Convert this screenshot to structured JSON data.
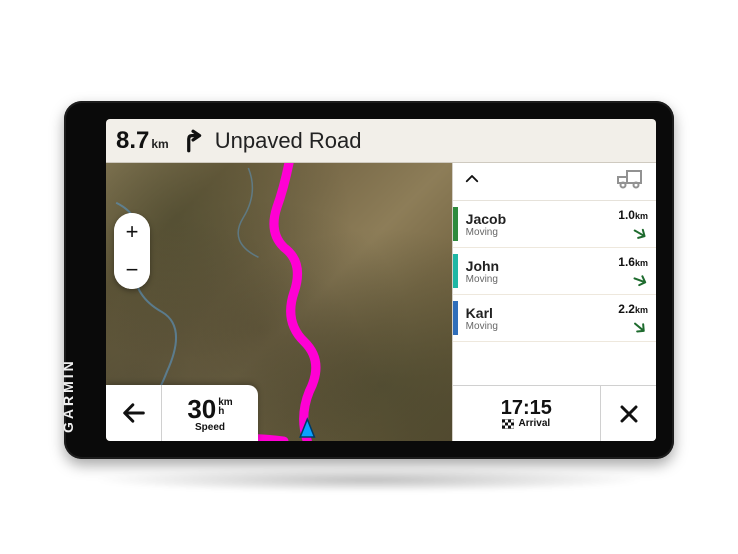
{
  "brand": "GARMIN",
  "nav": {
    "distance_value": "8.7",
    "distance_unit": "km",
    "turn_icon": "turn-right-icon",
    "road_name": "Unpaved Road"
  },
  "zoom": {
    "in_label": "+",
    "out_label": "−"
  },
  "speed": {
    "value": "30",
    "unit_top": "km",
    "unit_bottom": "h",
    "label": "Speed"
  },
  "side": {
    "collapse_icon": "chevron-up-icon",
    "profile_icon": "rv-profile-icon",
    "riders": [
      {
        "name": "Jacob",
        "status": "Moving",
        "distance": "1.0",
        "unit": "km",
        "color": "#2e8b3d",
        "dir_deg": 30
      },
      {
        "name": "John",
        "status": "Moving",
        "distance": "1.6",
        "unit": "km",
        "color": "#1fb7a4",
        "dir_deg": 20
      },
      {
        "name": "Karl",
        "status": "Moving",
        "distance": "2.2",
        "unit": "km",
        "color": "#2f6eba",
        "dir_deg": 40
      }
    ]
  },
  "arrival": {
    "time": "17:15",
    "label": "Arrival",
    "icon": "flag-icon"
  },
  "map": {
    "route_color": "#ff00d4"
  }
}
